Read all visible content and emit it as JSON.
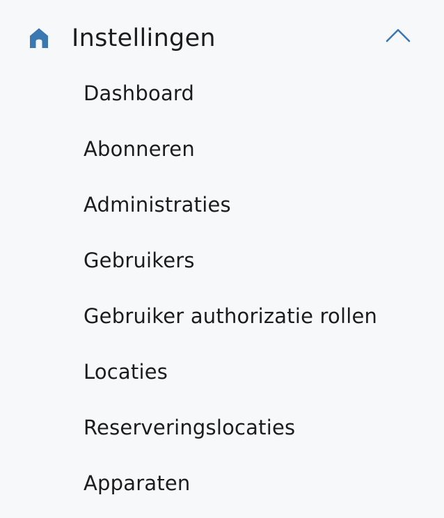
{
  "section": {
    "title": "Instellingen",
    "icon": "home-icon",
    "expanded": true,
    "accent_color": "#3b77b1",
    "chevron": "chevron-up-icon"
  },
  "submenu": {
    "items": [
      {
        "label": "Dashboard"
      },
      {
        "label": "Abonneren"
      },
      {
        "label": "Administraties"
      },
      {
        "label": "Gebruikers"
      },
      {
        "label": "Gebruiker authorizatie rollen"
      },
      {
        "label": "Locaties"
      },
      {
        "label": "Reserveringslocaties"
      },
      {
        "label": "Apparaten"
      }
    ]
  }
}
